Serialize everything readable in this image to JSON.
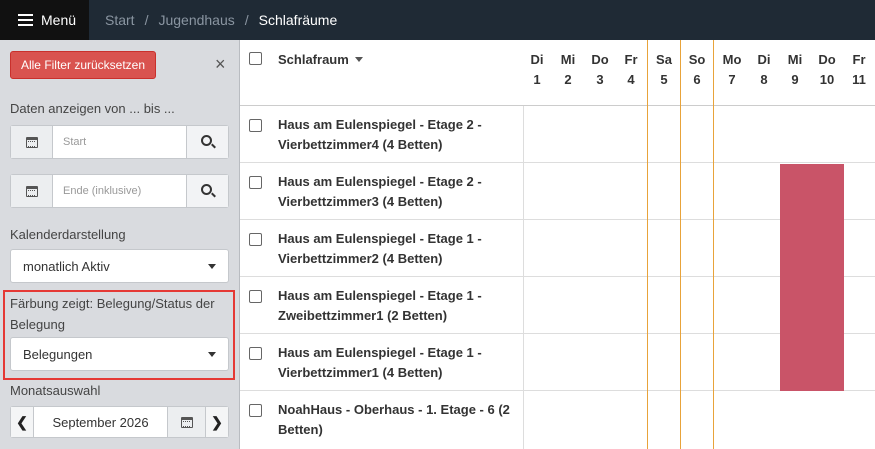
{
  "topbar": {
    "menu_label": "Menü",
    "breadcrumb": [
      "Start",
      "Jugendhaus",
      "Schlafräume"
    ]
  },
  "sidebar": {
    "reset_label": "Alle Filter zurücksetzen",
    "close_symbol": "×",
    "date_range_label": "Daten anzeigen von ... bis ...",
    "start_placeholder": "Start",
    "end_placeholder": "Ende (inklusive)",
    "calendar_view_label": "Kalenderdarstellung",
    "calendar_view_value": "monatlich Aktiv",
    "coloring_label": "Färbung zeigt: Belegung/Status der Belegung",
    "coloring_value": "Belegungen",
    "month_label": "Monatsauswahl",
    "month_value": "September 2026",
    "prev_symbol": "❮",
    "next_symbol": "❯"
  },
  "grid": {
    "column_header": "Schlafraum",
    "days": [
      {
        "weekday": "Di",
        "day": "1"
      },
      {
        "weekday": "Mi",
        "day": "2"
      },
      {
        "weekday": "Do",
        "day": "3"
      },
      {
        "weekday": "Fr",
        "day": "4"
      },
      {
        "weekday": "Sa",
        "day": "5"
      },
      {
        "weekday": "So",
        "day": "6"
      },
      {
        "weekday": "Mo",
        "day": "7"
      },
      {
        "weekday": "Di",
        "day": "8"
      },
      {
        "weekday": "Mi",
        "day": "9"
      },
      {
        "weekday": "Do",
        "day": "10"
      },
      {
        "weekday": "Fr",
        "day": "11"
      }
    ],
    "rooms": [
      "Haus am Eulenspiegel - Etage 2 - Vierbettzimmer4 (4 Betten)",
      "Haus am Eulenspiegel - Etage 2 - Vierbettzimmer3 (4 Betten)",
      "Haus am Eulenspiegel - Etage 1 - Vierbettzimmer2 (4 Betten)",
      "Haus am Eulenspiegel - Etage 1 - Zweibettzimmer1 (2 Betten)",
      "Haus am Eulenspiegel - Etage 1 - Vierbettzimmer1 (4 Betten)",
      "NoahHaus - Oberhaus - 1. Etage - 6 (2 Betten)"
    ],
    "weekend_line_color": "#e8a33a",
    "booking_color": "#c95468"
  }
}
